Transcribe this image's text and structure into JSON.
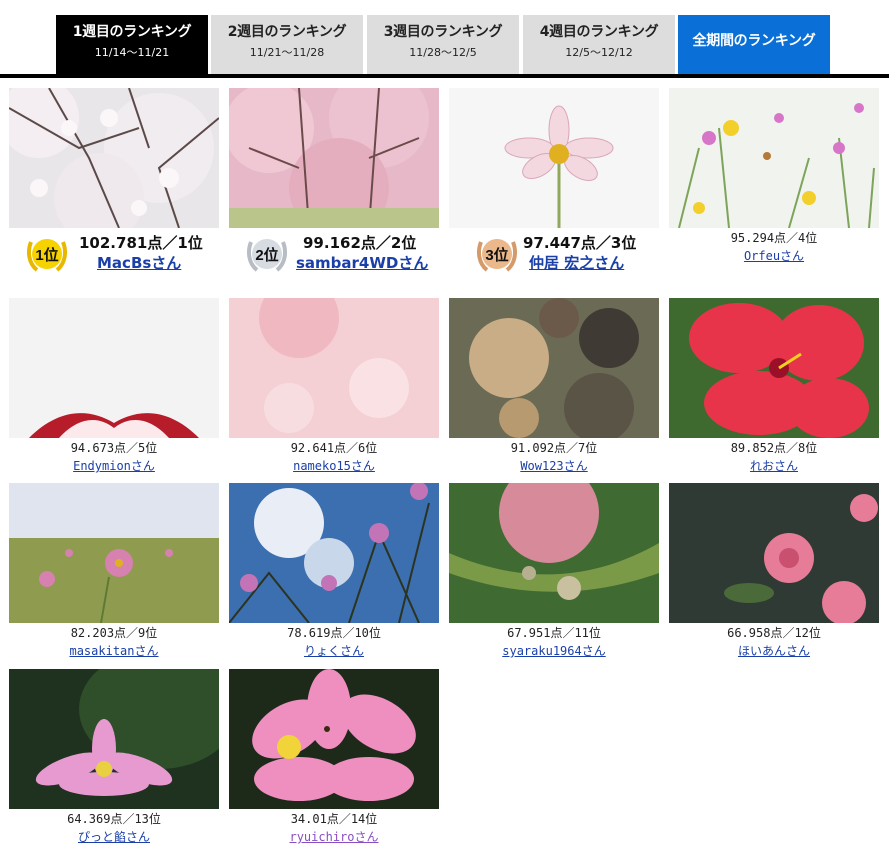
{
  "tabs": [
    {
      "title": "1週目のランキング",
      "dates": "11/14〜11/21"
    },
    {
      "title": "2週目のランキング",
      "dates": "11/21〜11/28"
    },
    {
      "title": "3週目のランキング",
      "dates": "11/28〜12/5"
    },
    {
      "title": "4週目のランキング",
      "dates": "12/5〜12/12"
    },
    {
      "title": "全期間のランキング",
      "dates": ""
    }
  ],
  "top3": [
    {
      "badge": "1位",
      "score": "102.781点／1位",
      "user": "MacBsさん"
    },
    {
      "badge": "2位",
      "score": "99.162点／2位",
      "user": "sambar4WDさん"
    },
    {
      "badge": "3位",
      "score": "97.447点／3位",
      "user": "仲居 宏之さん"
    }
  ],
  "entries": [
    {
      "score": "95.294点／4位",
      "user": "Orfeuさん"
    },
    {
      "score": "94.673点／5位",
      "user": "Endymionさん"
    },
    {
      "score": "92.641点／6位",
      "user": "nameko15さん"
    },
    {
      "score": "91.092点／7位",
      "user": "Wow123さん"
    },
    {
      "score": "89.852点／8位",
      "user": "れおさん"
    },
    {
      "score": "82.203点／9位",
      "user": "masakitanさん"
    },
    {
      "score": "78.619点／10位",
      "user": "りょくさん"
    },
    {
      "score": "67.951点／11位",
      "user": "syaraku1964さん"
    },
    {
      "score": "66.958点／12位",
      "user": "ほいあんさん"
    },
    {
      "score": "64.369点／13位",
      "user": "ぴっと餡さん"
    },
    {
      "score": "34.01点／14位",
      "user": "ryuichiroさん"
    }
  ],
  "colors": {
    "active_tab": "#000000",
    "inactive_tab": "#dddddd",
    "all_tab": "#0a6fd6",
    "link": "#1a3fa8",
    "visited_link": "#8a4fc2",
    "gold": "#e8b800",
    "silver": "#b8bcc4",
    "bronze": "#d49a6a"
  }
}
